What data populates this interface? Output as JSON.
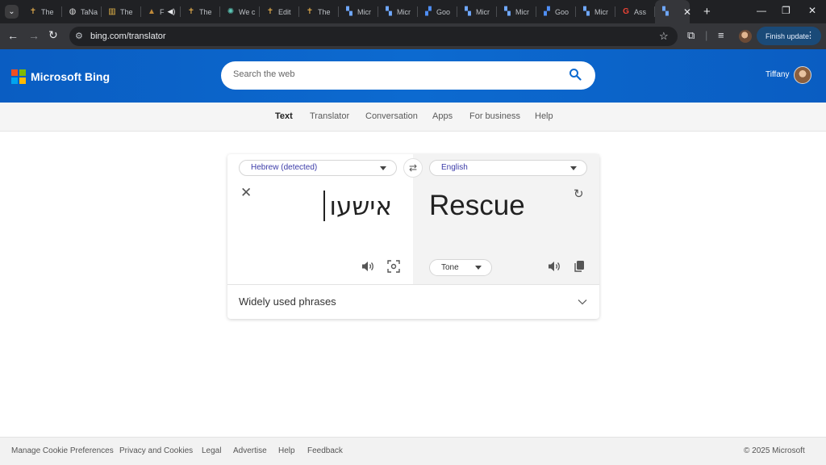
{
  "browser": {
    "tabs": [
      {
        "icon": "cross-icon",
        "label": "The"
      },
      {
        "icon": "globe-icon",
        "label": "TaNa"
      },
      {
        "icon": "book-icon",
        "label": "The"
      },
      {
        "icon": "tower-icon",
        "label": "F"
      },
      {
        "icon": "cross-icon",
        "label": "The"
      },
      {
        "icon": "chatgpt-icon",
        "label": "We c"
      },
      {
        "icon": "cross-icon",
        "label": "Edit"
      },
      {
        "icon": "cross-icon",
        "label": "The"
      },
      {
        "icon": "translator-icon",
        "label": "Micr"
      },
      {
        "icon": "translator-icon",
        "label": "Micr"
      },
      {
        "icon": "google-translate-icon",
        "label": "Goo"
      },
      {
        "icon": "translator-icon",
        "label": "Micr"
      },
      {
        "icon": "translator-icon",
        "label": "Micr"
      },
      {
        "icon": "google-translate-icon",
        "label": "Goo"
      },
      {
        "icon": "translator-icon",
        "label": "Micr"
      },
      {
        "icon": "google-icon",
        "label": "Ass"
      }
    ],
    "active_tab_icon": "translator-icon",
    "url": "bing.com/translator",
    "finish_update_label": "Finish update"
  },
  "header": {
    "brand": "Microsoft Bing",
    "logo_colors": [
      "#f25022",
      "#7fba00",
      "#00a4ef",
      "#ffb900"
    ],
    "search_placeholder": "Search the web",
    "user_name": "Tiffany"
  },
  "subnav": {
    "items": [
      "Text",
      "Translator",
      "Conversation",
      "Apps",
      "For business",
      "Help"
    ],
    "active": "Text"
  },
  "translator": {
    "source_language": "Hebrew (detected)",
    "target_language": "English",
    "source_text": "אישעו",
    "target_text": "Rescue",
    "tone_label": "Tone",
    "phrases_label": "Widely used phrases"
  },
  "footer": {
    "links": [
      "Manage Cookie Preferences",
      "Privacy and Cookies",
      "Legal",
      "Advertise",
      "Help",
      "Feedback"
    ],
    "copyright": "© 2025 Microsoft"
  }
}
